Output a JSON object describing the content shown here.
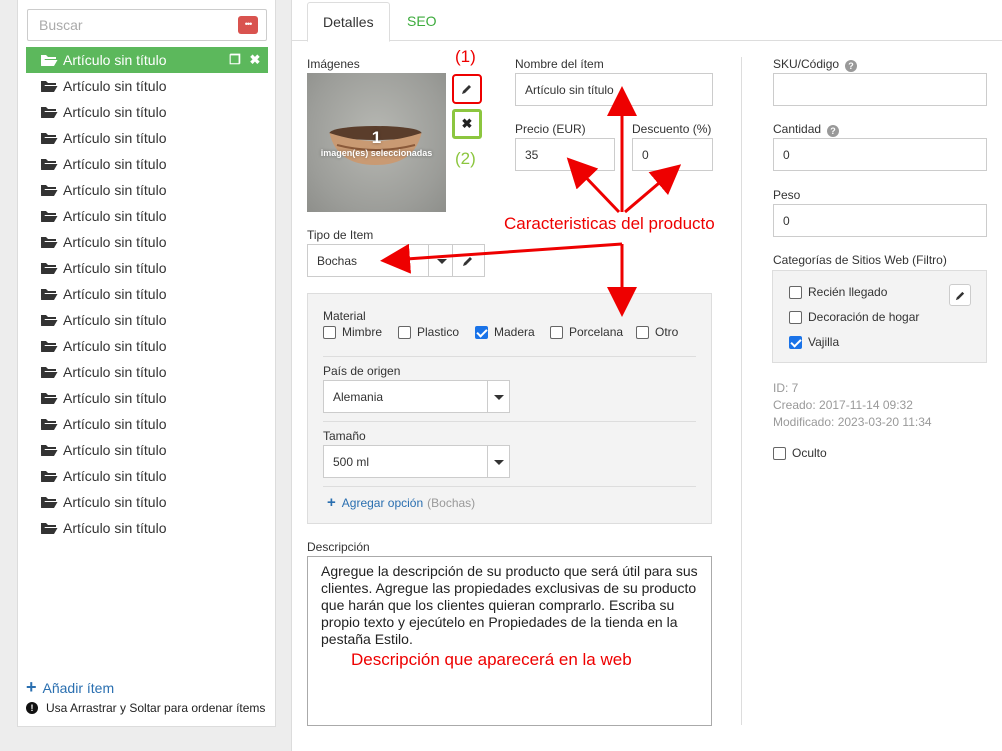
{
  "search": {
    "placeholder": "Buscar"
  },
  "items": [
    {
      "label": "Artículo sin título",
      "active": true
    },
    {
      "label": "Artículo sin título"
    },
    {
      "label": "Artículo sin título"
    },
    {
      "label": "Artículo sin título"
    },
    {
      "label": "Artículo sin título"
    },
    {
      "label": "Artículo sin título"
    },
    {
      "label": "Artículo sin título"
    },
    {
      "label": "Artículo sin título"
    },
    {
      "label": "Artículo sin título"
    },
    {
      "label": "Artículo sin título"
    },
    {
      "label": "Artículo sin título"
    },
    {
      "label": "Artículo sin título"
    },
    {
      "label": "Artículo sin título"
    },
    {
      "label": "Artículo sin título"
    },
    {
      "label": "Artículo sin título"
    },
    {
      "label": "Artículo sin título"
    },
    {
      "label": "Artículo sin título"
    },
    {
      "label": "Artículo sin título"
    },
    {
      "label": "Artículo sin título"
    }
  ],
  "sidebar": {
    "add_item": "Añadir ítem",
    "hint": "Usa Arrastrar y Soltar para ordenar ítems"
  },
  "tabs": [
    {
      "label": "Detalles",
      "active": true
    },
    {
      "label": "SEO"
    }
  ],
  "images": {
    "label": "Imágenes",
    "count": "1",
    "caption": "imagen(es) seleccionadas"
  },
  "fields": {
    "name_label": "Nombre del ítem",
    "name_value": "Artículo sin título",
    "price_label": "Precio (EUR)",
    "price_value": "35",
    "discount_label": "Descuento (%)",
    "discount_value": "0",
    "type_label": "Tipo de Item",
    "type_value": "Bochas",
    "sku_label": "SKU/Código",
    "sku_value": "",
    "qty_label": "Cantidad",
    "qty_value": "0",
    "weight_label": "Peso",
    "weight_value": "0"
  },
  "attributes": {
    "material_label": "Material",
    "materials": [
      {
        "label": "Mimbre",
        "checked": false
      },
      {
        "label": "Plastico",
        "checked": false
      },
      {
        "label": "Madera",
        "checked": true
      },
      {
        "label": "Porcelana",
        "checked": false
      },
      {
        "label": "Otro",
        "checked": false
      }
    ],
    "origin_label": "País de origen",
    "origin_value": "Alemania",
    "size_label": "Tamaño",
    "size_value": "500 ml",
    "add_option": "Agregar opción",
    "add_option_context": "(Bochas)"
  },
  "description": {
    "label": "Descripción",
    "text": "Agregue la descripción de su producto que será útil para sus clientes. Agregue las propiedades exclusivas de su producto que harán que los clientes quieran comprarlo. Escriba su propio texto y ejecútelo en Propiedades de la tienda en la pestaña Estilo."
  },
  "categories": {
    "label": "Categorías de Sitios Web (Filtro)",
    "items": [
      {
        "label": "Recién llegado",
        "checked": false
      },
      {
        "label": "Decoración de hogar",
        "checked": false
      },
      {
        "label": "Vajilla",
        "checked": true
      }
    ]
  },
  "meta": {
    "id": "ID: 7",
    "created": "Creado: 2017-11-14 09:32",
    "modified": "Modificado: 2023-03-20 11:34",
    "hidden_label": "Oculto"
  },
  "annotations": {
    "one": "(1)",
    "two": "(2)",
    "features": "Caracteristicas del producto",
    "web_desc": "Descripción que aparecerá en la web"
  },
  "colors": {
    "active_item": "#5cb85c",
    "seo_tab": "#3cab3c",
    "link": "#2a6fb0",
    "annotation": "#ee0000",
    "annotation_green": "#8cc63f",
    "checkbox_on": "#1a73e8"
  }
}
